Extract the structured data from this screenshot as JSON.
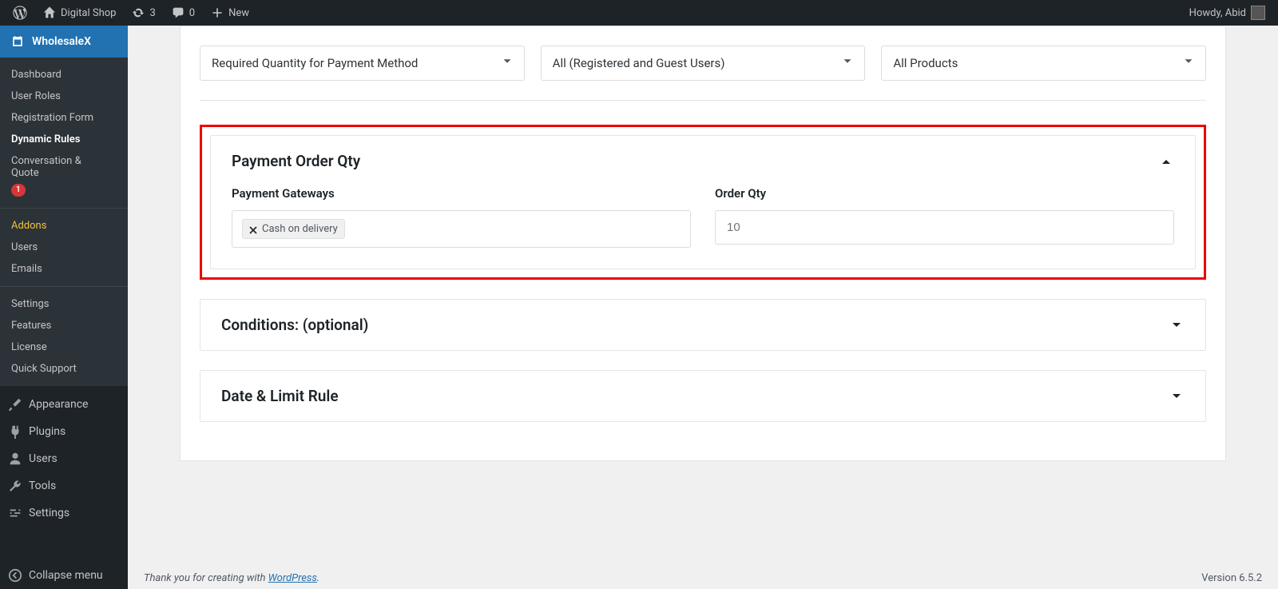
{
  "adminbar": {
    "site_name": "Digital Shop",
    "updates_count": "3",
    "comments_count": "0",
    "new_label": "New",
    "greeting": "Howdy, Abid"
  },
  "sidebar": {
    "plugin": "WholesaleX",
    "plugin_items": [
      {
        "label": "Dashboard",
        "active": false
      },
      {
        "label": "User Roles",
        "active": false
      },
      {
        "label": "Registration Form",
        "active": false
      },
      {
        "label": "Dynamic Rules",
        "active": true
      },
      {
        "label": "Conversation & Quote",
        "active": false,
        "badge": "1"
      }
    ],
    "plugin_items2": [
      {
        "label": "Addons",
        "highlight": true
      },
      {
        "label": "Users"
      },
      {
        "label": "Emails"
      }
    ],
    "plugin_items3": [
      {
        "label": "Settings"
      },
      {
        "label": "Features"
      },
      {
        "label": "License"
      },
      {
        "label": "Quick Support"
      }
    ],
    "main_items": [
      {
        "label": "Appearance",
        "icon": "brush"
      },
      {
        "label": "Plugins",
        "icon": "plug"
      },
      {
        "label": "Users",
        "icon": "user"
      },
      {
        "label": "Tools",
        "icon": "wrench"
      },
      {
        "label": "Settings",
        "icon": "sliders"
      }
    ],
    "collapse": "Collapse menu"
  },
  "selects": {
    "rule_type": "Required Quantity for Payment Method",
    "user_scope": "All (Registered and Guest Users)",
    "product_scope": "All Products"
  },
  "panels": {
    "payment": {
      "title": "Payment Order Qty",
      "gateways_label": "Payment Gateways",
      "gateway_tag": "Cash on delivery",
      "qty_label": "Order Qty",
      "qty_placeholder": "10"
    },
    "conditions": {
      "title": "Conditions: (optional)"
    },
    "date": {
      "title": "Date & Limit Rule"
    }
  },
  "footer": {
    "thanks_prefix": "Thank you for creating with ",
    "link": "WordPress",
    "suffix": ".",
    "version": "Version 6.5.2"
  }
}
